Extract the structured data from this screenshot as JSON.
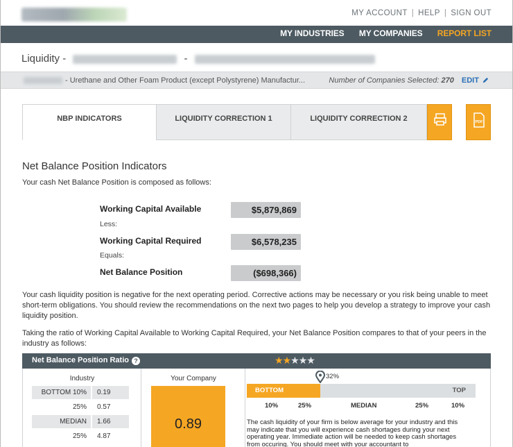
{
  "header": {
    "account_links": [
      "MY ACCOUNT",
      "HELP",
      "SIGN OUT"
    ]
  },
  "nav": {
    "items": [
      {
        "label": "MY INDUSTRIES",
        "active": false
      },
      {
        "label": "MY COMPANIES",
        "active": false
      },
      {
        "label": "REPORT LIST",
        "active": true
      }
    ]
  },
  "title": {
    "prefix": "Liquidity -",
    "separator": "-"
  },
  "subbar": {
    "naics_text": "- Urethane and Other Foam Product (except Polystyrene) Manufactur...",
    "count_label": "Number of Companies Selected:",
    "count_value": "270",
    "edit_label": "EDIT"
  },
  "tabs": [
    {
      "label": "NBP INDICATORS",
      "active": true
    },
    {
      "label": "LIQUIDITY CORRECTION 1",
      "active": false
    },
    {
      "label": "LIQUIDITY CORRECTION 2",
      "active": false
    }
  ],
  "tab_buttons": {
    "print_icon": "printer-icon",
    "pdf_icon": "pdf-icon",
    "pdf_text": "PDF"
  },
  "content": {
    "heading": "Net Balance Position Indicators",
    "intro": "Your cash Net Balance Position is composed as follows:",
    "wca_label": "Working Capital Available",
    "wca_value": "$5,879,869",
    "less": "Less:",
    "wcr_label": "Working Capital Required",
    "wcr_value": "$6,578,235",
    "equals": "Equals:",
    "nbp_label": "Net Balance Position",
    "nbp_value": "($698,366)",
    "para1": "Your cash liquidity position is negative for the next operating period. Corrective actions may be necessary or you risk being unable to meet short-term obligations. You should review the recommendations on the next two pages to help you develop a strategy to improve your cash liquidity position.",
    "para2": "Taking the ratio of Working Capital Available to Working Capital Required, your Net Balance Position compares to that of your peers in the industry as follows:"
  },
  "ratio": {
    "title": "Net Balance Position Ratio",
    "help_symbol": "?",
    "stars_filled": 2,
    "stars_total": 5,
    "industry_header": "Industry",
    "industry_rows": [
      {
        "label": "BOTTOM 10%",
        "value": "0.19"
      },
      {
        "label": "25%",
        "value": "0.57"
      },
      {
        "label": "MEDIAN",
        "value": "1.66"
      },
      {
        "label": "25%",
        "value": "4.87"
      }
    ],
    "company_header": "Your Company",
    "company_value": "0.89",
    "percentile_label": "32%",
    "percentile": 0.32,
    "bar_bottom": "BOTTOM",
    "bar_top": "TOP",
    "ticks": [
      "10%",
      "25%",
      "MEDIAN",
      "25%",
      "10%"
    ],
    "description": "The cash liquidity of your firm is below average for your industry and this may indicate that you will experience cash shortages during your next operating year. Immediate action will be needed to keep cash shortages from occuring. You should meet with your accountant to"
  },
  "colors": {
    "accent": "#f5a623",
    "nav_bg": "#4d5a62",
    "link": "#2a6fb5"
  }
}
